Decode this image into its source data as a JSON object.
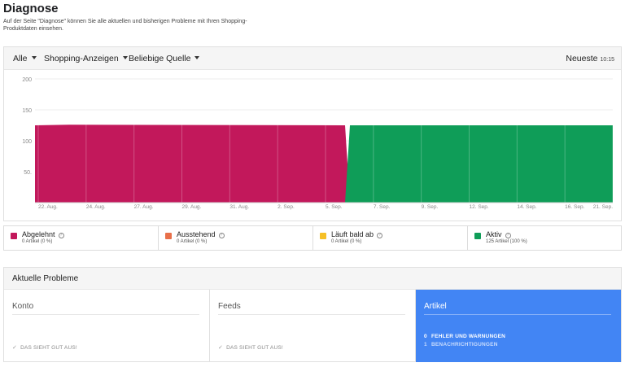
{
  "page": {
    "title": "Diagnose",
    "description": "Auf der Seite \"Diagnose\" können Sie alle aktuellen und bisherigen Probleme mit Ihren Shopping-Produktdaten einsehen."
  },
  "filters": {
    "scope": "Alle",
    "type": "Shopping-Anzeigen",
    "source": "Beliebige Quelle",
    "sort_label": "Neueste",
    "sort_time": "10:15"
  },
  "chart_data": {
    "type": "area",
    "y_ticks": [
      50,
      100,
      150,
      200
    ],
    "y_tick_labels": [
      "50.",
      "100",
      "150",
      "200"
    ],
    "ylim": [
      0,
      200
    ],
    "x_tick_labels": [
      "22. Aug.",
      "24. Aug.",
      "27. Aug.",
      "29. Aug.",
      "31. Aug.",
      "2. Sep.",
      "5. Sep.",
      "7. Sep.",
      "9. Sep.",
      "12. Sep.",
      "14. Sep.",
      "16. Sep.",
      "21. Sep."
    ],
    "x": [
      "22. Aug.",
      "23. Aug.",
      "6. Sep.",
      "7. Sep.",
      "21. Sep."
    ],
    "series": [
      {
        "name": "Abgelehnt",
        "color": "#c2185b",
        "values": [
          125,
          126,
          125,
          0,
          0
        ]
      },
      {
        "name": "Aktiv",
        "color": "#0f9d58",
        "values": [
          0,
          0,
          0,
          125,
          125
        ]
      }
    ],
    "grid": true
  },
  "legend": [
    {
      "label": "Abgelehnt",
      "color": "#c2185b",
      "count": "0 Artikel (0 %)"
    },
    {
      "label": "Ausstehend",
      "color": "#e8704a",
      "count": "0 Artikel (0 %)"
    },
    {
      "label": "Läuft bald ab",
      "color": "#f6c026",
      "count": "0 Artikel (0 %)"
    },
    {
      "label": "Aktiv",
      "color": "#0f9d58",
      "count": "125 Artikel (100 %)"
    }
  ],
  "problems": {
    "title": "Aktuelle Probleme",
    "panels": [
      {
        "title": "Konto",
        "status": "DAS SIEHT GUT AUS!"
      },
      {
        "title": "Feeds",
        "status": "DAS SIEHT GUT AUS!"
      },
      {
        "title": "Artikel",
        "line1_num": "0",
        "line1_text": "FEHLER UND WARNUNGEN",
        "line2_num": "1",
        "line2_text": "BENACHRICHTIGUNGEN"
      }
    ]
  },
  "colors": {
    "accent": "#4285f4"
  }
}
